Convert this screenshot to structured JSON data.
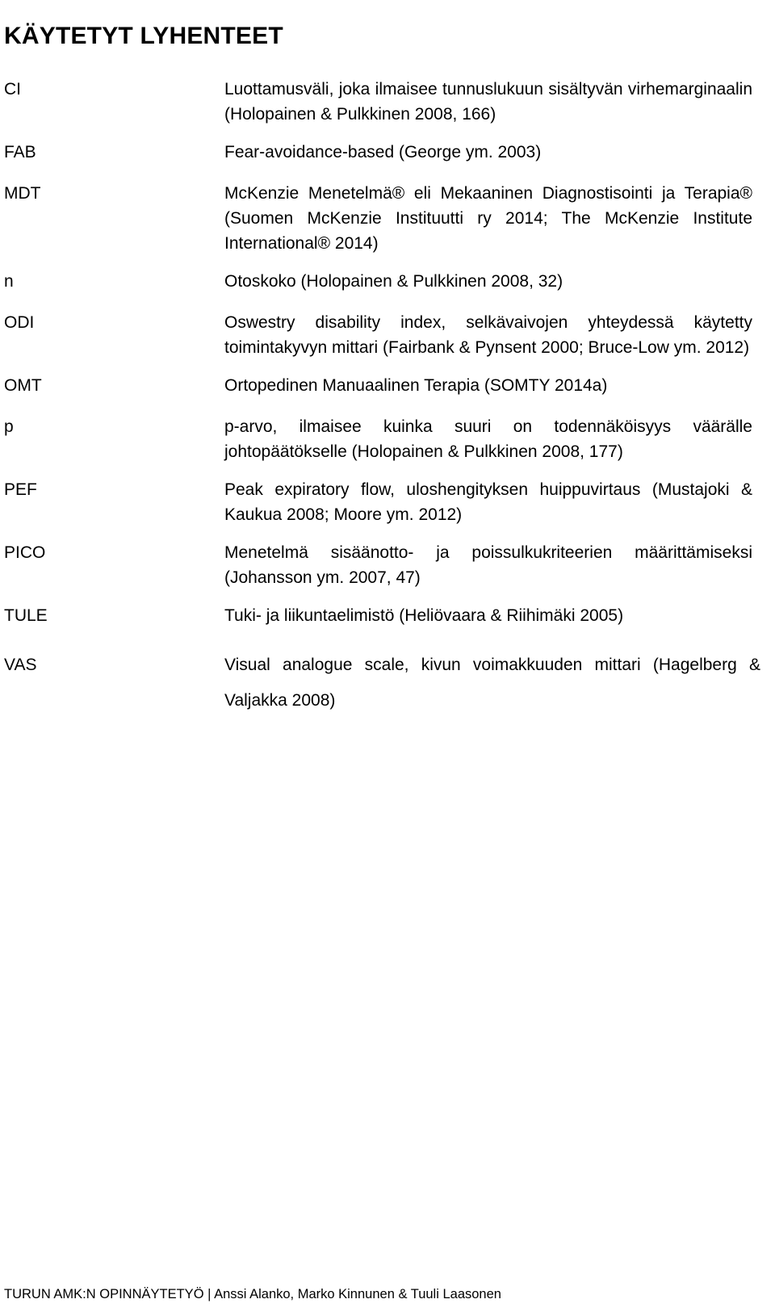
{
  "document": {
    "title": "KÄYTETYT LYHENTEET",
    "language": "fi"
  },
  "abbreviations": [
    {
      "term": "CI",
      "definition": "Luottamusväli, joka ilmaisee tunnuslukuun sisältyvän virhemarginaalin (Holopainen & Pulkkinen 2008, 166)"
    },
    {
      "term": "FAB",
      "definition": "Fear-avoidance-based (George ym. 2003)"
    },
    {
      "term": "MDT",
      "definition": "McKenzie Menetelmä® eli Mekaaninen Diagnostisointi ja Terapia® (Suomen McKenzie Instituutti ry 2014; The McKenzie Institute International® 2014)"
    },
    {
      "term": "n",
      "definition": "Otoskoko (Holopainen & Pulkkinen 2008, 32)"
    },
    {
      "term": "ODI",
      "definition": "Oswestry disability index, selkävaivojen yhteydessä käytetty toimintakyvyn mittari (Fairbank & Pynsent 2000; Bruce-Low ym. 2012)"
    },
    {
      "term": "OMT",
      "definition": "Ortopedinen Manuaalinen Terapia (SOMTY 2014a)"
    },
    {
      "term": "p",
      "definition": "p-arvo, ilmaisee kuinka suuri on todennäköisyys väärälle johtopäätökselle (Holopainen & Pulkkinen 2008, 177)"
    },
    {
      "term": "PEF",
      "definition": "Peak expiratory flow, uloshengityksen huippuvirtaus (Mustajoki & Kaukua 2008; Moore ym. 2012)"
    },
    {
      "term": "PICO",
      "definition": "Menetelmä sisäänotto- ja poissulkukriteerien määrittämiseksi (Johansson ym. 2007, 47)"
    },
    {
      "term": "TULE",
      "definition": "Tuki- ja liikuntaelimistö (Heliövaara & Riihimäki 2005)"
    },
    {
      "term": "VAS",
      "definition": "Visual analogue scale, kivun voimakkuuden mittari (Hagelberg & Valjakka 2008)"
    }
  ],
  "footer": {
    "text": "TURUN AMK:N OPINNÄYTETYÖ | Anssi Alanko, Marko Kinnunen & Tuuli Laasonen"
  }
}
